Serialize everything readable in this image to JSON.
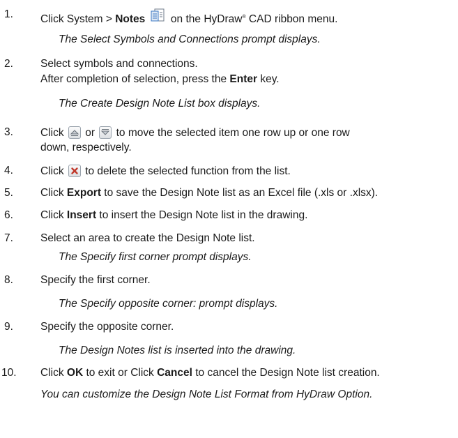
{
  "steps": [
    {
      "number": "1.",
      "pre": "Click System > ",
      "bold": "Notes",
      "post": " on the HyDraw",
      "reg": "®",
      "post2": " CAD ribbon menu.",
      "note": "The Select Symbols and Connections prompt displays."
    },
    {
      "number": "2.",
      "line1": "Select symbols and connections.",
      "line2_pre": "After completion of selection, press the ",
      "line2_bold": "Enter",
      "line2_post": " key.",
      "note": "The Create Design Note List box displays."
    },
    {
      "number": "3.",
      "pre": "Click ",
      "mid": " or ",
      "post": " to move the selected item one row up or one row",
      "line2": "down, respectively."
    },
    {
      "number": "4.",
      "pre": "Click ",
      "post": " to delete the selected function from the list."
    },
    {
      "number": "5.",
      "pre": "Click ",
      "bold": "Export",
      "post": " to save the Design Note list as an Excel file (.xls or .xlsx)."
    },
    {
      "number": "6.",
      "pre": "Click ",
      "bold": "Insert",
      "post": " to insert the Design Note list in the drawing."
    },
    {
      "number": "7.",
      "text": "Select an area to create the Design Note list.",
      "note": "The Specify first corner prompt displays."
    },
    {
      "number": "8.",
      "text": "Specify the first corner.",
      "note": "The Specify opposite corner: prompt displays."
    },
    {
      "number": "9.",
      "text": "Specify the opposite corner.",
      "note": "The Design Notes list is inserted into the drawing."
    },
    {
      "number": "10.",
      "pre": "Click ",
      "bold1": "OK",
      "mid": " to exit or Click ",
      "bold2": "Cancel",
      "post": " to cancel the Design Note list creation.",
      "note": "You can customize the Design Note List Format from HyDraw Option."
    }
  ],
  "icons": {
    "notes": "notes-icon",
    "up": "arrow-up-icon",
    "down": "arrow-down-icon",
    "delete": "delete-icon"
  },
  "colors": {
    "text": "#1a1a1a",
    "delete_icon": "#c0392b",
    "notes_icon_blue": "#3b78c4"
  }
}
